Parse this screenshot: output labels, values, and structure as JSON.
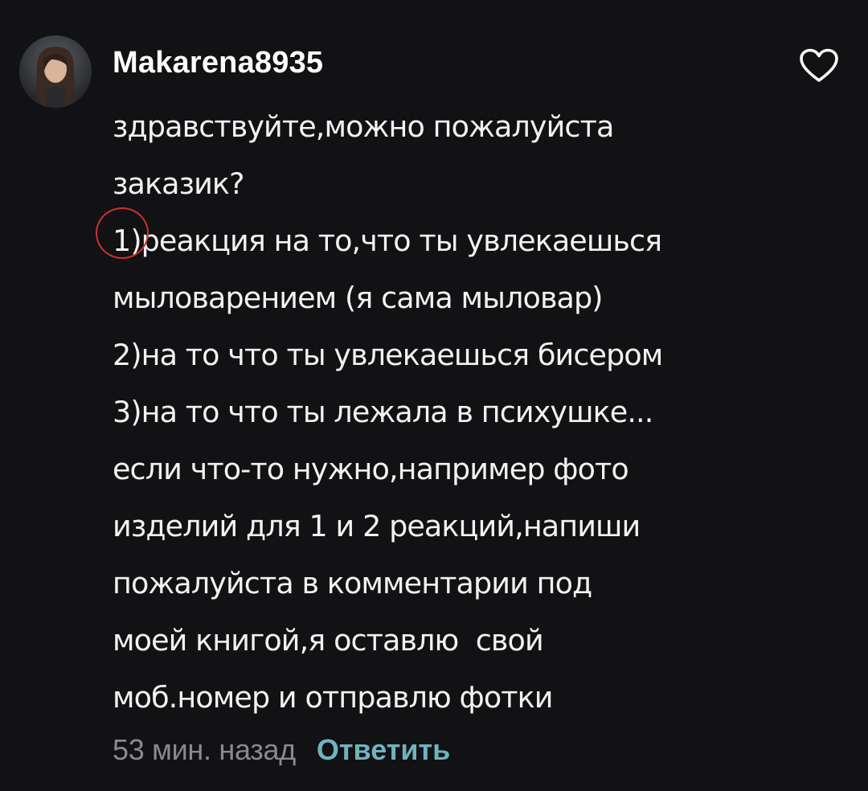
{
  "comment": {
    "username": "Makarena8935",
    "avatar_icon": "user-avatar-photo",
    "like_icon": "heart-outline-icon",
    "lines": [
      "здравствуйте,можно пожалуйста",
      "заказик?",
      "1)реакция на то,что ты увлекаешься",
      "мыловарением (я сама мыловар)",
      "2)на то что ты увлекаешься бисером",
      "3)на то что ты лежала в психушке...",
      "если что-то нужно,например фото",
      "изделий для 1 и 2 реакций,напиши",
      "пожалуйста в комментарии под",
      "моей книгой,я оставлю  свой",
      "моб.номер и отправлю фотки"
    ],
    "time_ago": "53 мин. назад",
    "reply_label": "Ответить"
  },
  "colors": {
    "background": "#121113",
    "text": "#f2f2f2",
    "muted": "#8a8a8e",
    "accent": "#6fb3c0",
    "annotation": "#cf3131"
  }
}
